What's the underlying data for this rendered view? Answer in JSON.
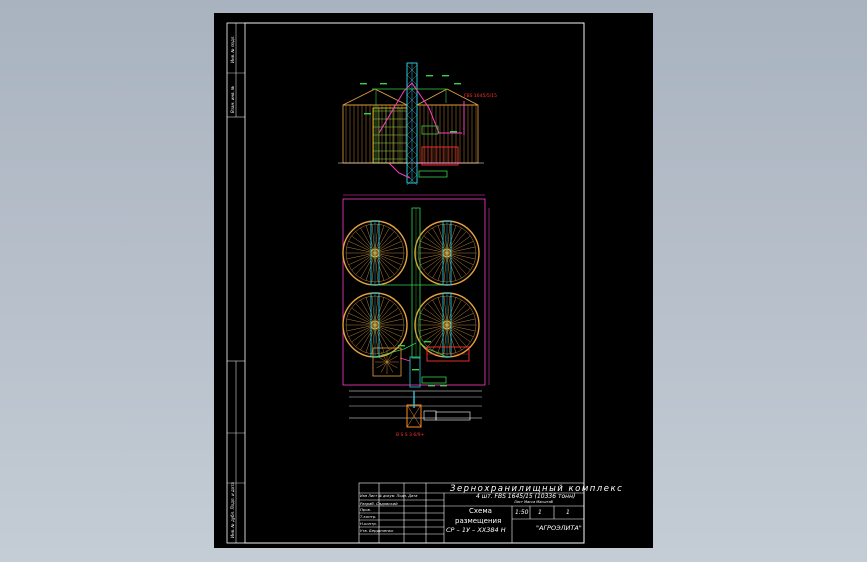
{
  "drawing": {
    "labels": {
      "fbs_top": "FBS 1645/5/15",
      "fbs_bottom": "B S S 3 6/9+"
    },
    "stamp": {
      "title_line1": "Зернохранилищный комплекс",
      "title_line2": "4 шт. FBS 1645/15 (10336 тонн)",
      "doc_name_line1": "Схема",
      "doc_name_line2": "размещения",
      "doc_code": "СР – 1У – ХХ384 Н",
      "company": "\"АГРОЭЛИТА\"",
      "scale": "1:50",
      "sheet": "1",
      "sheets": "1",
      "col_headers": "Изм Лист № докум. Подп. Дата",
      "col_right": "Лист Масса Масштаб",
      "row1": "Разраб. Садовский",
      "row2": "Пров.",
      "row3": "Т.контр.",
      "row4": "Н.контр.",
      "row5": "Утв. Бердиченко"
    },
    "side_labels": {
      "top": "Инв. № подл.",
      "mid": "Взам. инв. №",
      "bottom": "Инв. № дубл. Подп. и дата"
    }
  }
}
